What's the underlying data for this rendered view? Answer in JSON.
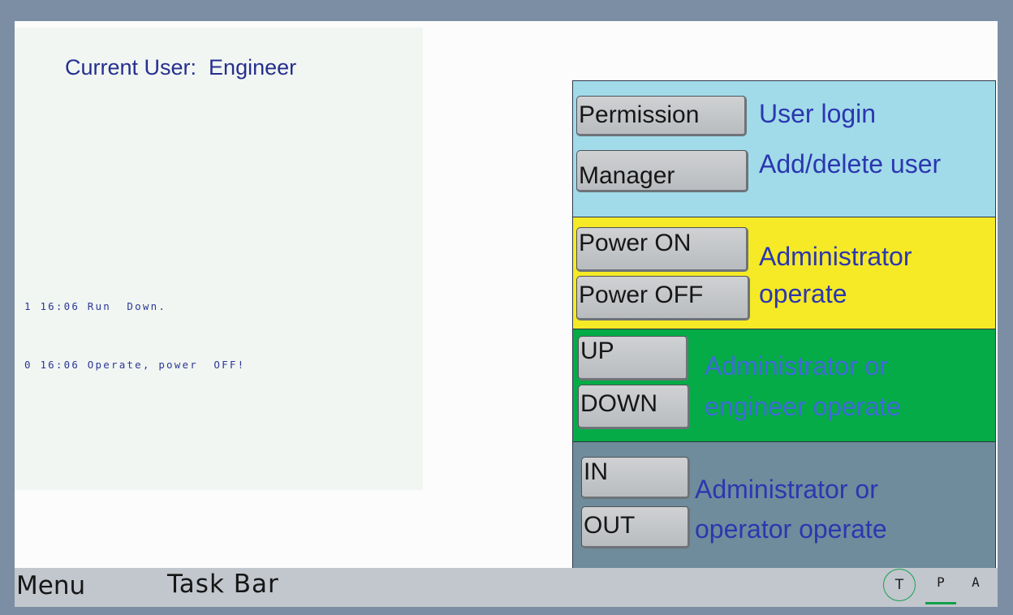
{
  "header": {
    "current_user": "Current User:  Engineer"
  },
  "log": {
    "lines": [
      "1 16:06 Run  Down.",
      "0 16:06 Operate, power  OFF!"
    ]
  },
  "panel": {
    "user_section": {
      "color": "#a1dbe9",
      "buttons": [
        "Permission",
        "Manager"
      ],
      "descriptions": [
        "User login",
        "Add/delete user"
      ]
    },
    "admin_section": {
      "color": "#f5ea25",
      "buttons": [
        "Power ON",
        "Power OFF"
      ],
      "description": [
        "Administrator",
        "operate"
      ]
    },
    "engineer_section": {
      "color": "#05ab47",
      "buttons": [
        "UP",
        "DOWN"
      ],
      "description": [
        "Administrator or",
        "engineer operate"
      ]
    },
    "operator_section": {
      "color": "#6f8c9c",
      "buttons": [
        "IN",
        "OUT"
      ],
      "description": [
        "Administrator or",
        "operator operate"
      ]
    }
  },
  "taskbar": {
    "menu_label": "Menu",
    "task_bar_label": "Task Bar",
    "modes": {
      "t": "T",
      "p": "P",
      "a": "A",
      "active": "P",
      "indicator_color": "#10a04a"
    }
  }
}
